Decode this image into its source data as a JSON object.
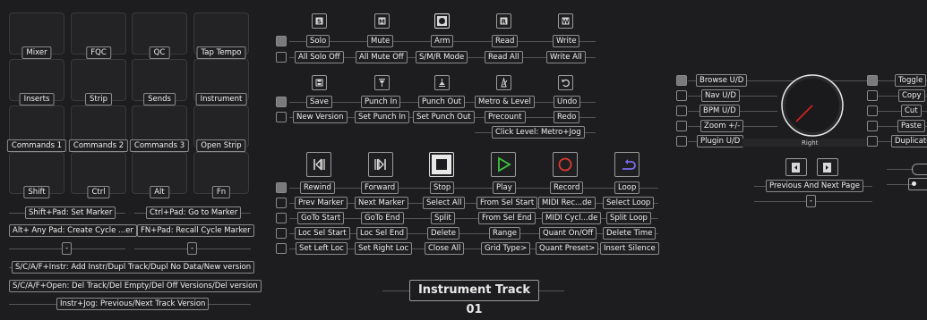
{
  "pads": {
    "row1": [
      "Mixer",
      "FQC",
      "QC",
      "Tap Tempo"
    ],
    "row2": [
      "Inserts",
      "Strip",
      "Sends",
      "Instrument"
    ],
    "row3": [
      "Commands 1",
      "Commands 2",
      "Commands 3",
      "Open Strip"
    ],
    "row4": [
      "Shift",
      "Ctrl",
      "Alt",
      "Fn"
    ]
  },
  "pad_hints": {
    "shift_pad": "Shift+Pad: Set Marker",
    "ctrl_pad": "Ctrl+Pad: Go to Marker",
    "alt_pad": "Alt+ Any Pad: Create Cycle ...er",
    "fn_pad": "FN+Pad: Recall Cycle Marker",
    "dash1": "-",
    "dash2": "-",
    "scaf_instr": "S/C/A/F+Instr: Add Instr/Dupl Track/Dupl No Data/New version",
    "scaf_open": "S/C/A/F+Open: Del Track/Del Empty/Del Off Versions/Del version",
    "instr_jog": "Instr+Jog: Previous/Next Track Version"
  },
  "track_row": {
    "top": [
      "Solo",
      "Mute",
      "Arm",
      "Read",
      "Write"
    ],
    "bottom": [
      "All Solo Off",
      "All Mute Off",
      "S/M/R Mode",
      "Read All",
      "Write All"
    ]
  },
  "edit_row": {
    "top": [
      "Save",
      "Punch In",
      "Punch Out",
      "Metro & Level",
      "Undo"
    ],
    "bottom": [
      "New Version",
      "Set Punch In",
      "Set Punch Out",
      "Precount",
      "Redo"
    ],
    "click": "Click Level: Metro+Jog"
  },
  "transport": {
    "labels": [
      "Rewind",
      "Forward",
      "Stop",
      "Play",
      "Record",
      "Loop"
    ],
    "colors": {
      "play": "#3ec43e",
      "record": "#e0392f",
      "loop": "#7b6cf0"
    }
  },
  "grid": {
    "r1": [
      "Prev Marker",
      "Next Marker",
      "Select All",
      "From Sel Start",
      "MIDI Rec...de",
      "Select Loop"
    ],
    "r2": [
      "GoTo Start",
      "GoTo End",
      "Split",
      "From Sel End",
      "MIDI Cycl...de",
      "Split Loop"
    ],
    "r3": [
      "Loc Sel Start",
      "Loc Sel End",
      "Delete",
      "Range",
      "Quant On/Off",
      "Delete Time"
    ],
    "r4": [
      "Set Left Loc",
      "Set Right Loc",
      "Close All",
      "Grid Type>",
      "Quant Preset>",
      "Insert Silence"
    ]
  },
  "browse": [
    "Browse U/D",
    "Nav U/D",
    "BPM U/D",
    "Zoom +/-",
    "Plugin U/D"
  ],
  "knob": {
    "label": "Right"
  },
  "right_col": [
    "Toggle",
    "Copy",
    "Cut",
    "Paste",
    "Duplicate"
  ],
  "page_nav": {
    "label": "Previous And Next Page",
    "dash": "-"
  },
  "track_name": "Instrument Track 01"
}
